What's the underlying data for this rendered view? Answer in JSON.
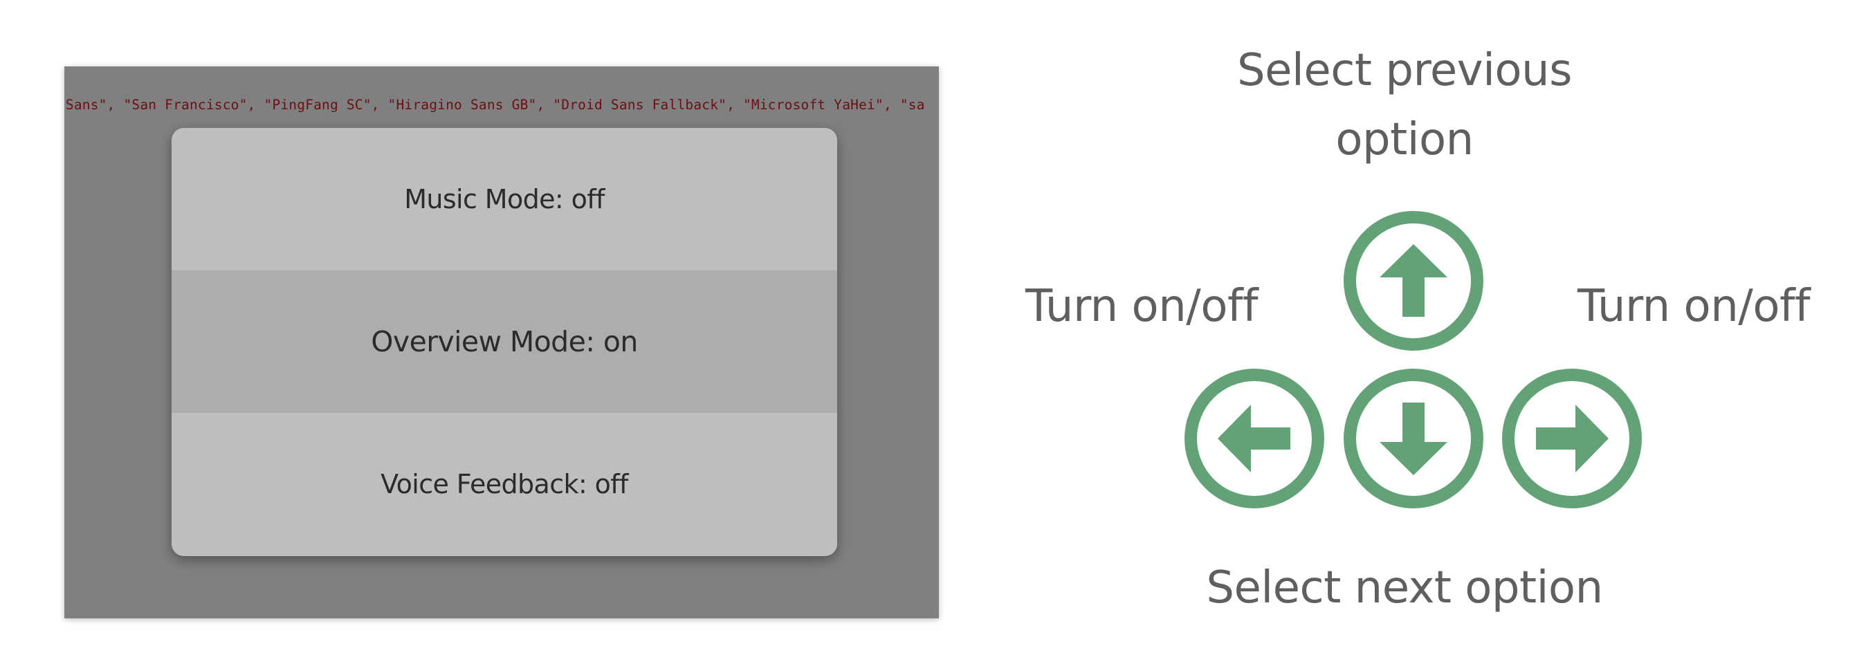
{
  "screen": {
    "code_text": "n Sans\", \"San Francisco\", \"PingFang SC\", \"Hiragino Sans GB\", \"Droid Sans Fallback\", \"Microsoft YaHei\", \"sa",
    "menu": {
      "items": [
        {
          "label": "Music Mode: off"
        },
        {
          "label": "Overview Mode: on"
        },
        {
          "label": "Voice Feedback: off"
        }
      ],
      "selected_index": 1
    }
  },
  "controls": {
    "up_label": "Select previous option",
    "down_label": "Select next option",
    "left_label": "Turn on/off",
    "right_label": "Turn on/off",
    "keys": [
      {
        "icon": "arrow-up-icon"
      },
      {
        "icon": "arrow-left-icon"
      },
      {
        "icon": "arrow-down-icon"
      },
      {
        "icon": "arrow-right-icon"
      }
    ]
  },
  "colors": {
    "key_green": "#62a276",
    "backdrop": "#808080",
    "modal_bg": "#bebebe",
    "modal_selected": "#adadad",
    "code_text": "#6d0f12",
    "label_text": "#5f5f5f"
  }
}
